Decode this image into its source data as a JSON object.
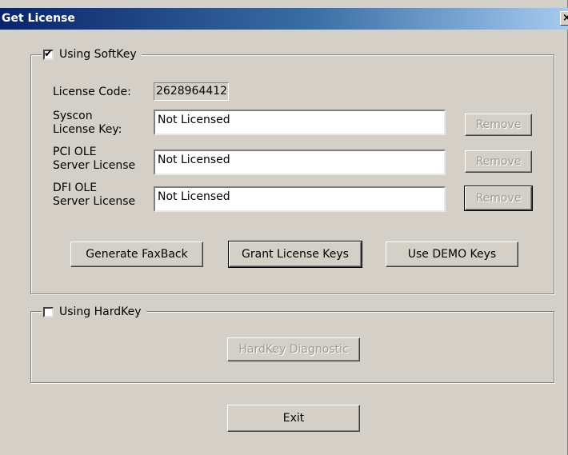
{
  "window": {
    "title": "Get License",
    "close_glyph": "×"
  },
  "softkey_group": {
    "checkbox_label": "Using SoftKey",
    "checked": true,
    "license_code_label": "License Code:",
    "license_code_value": "2628964412",
    "rows": [
      {
        "label_line1": "Syscon",
        "label_line2": "License Key:",
        "value": "Not Licensed",
        "remove_label": "Remove"
      },
      {
        "label_line1": "PCI OLE",
        "label_line2": "Server License",
        "value": "Not Licensed",
        "remove_label": "Remove"
      },
      {
        "label_line1": "DFI OLE",
        "label_line2": "Server License",
        "value": "Not Licensed",
        "remove_label": "Remove"
      }
    ],
    "buttons": {
      "generate_faxback": "Generate FaxBack",
      "grant_license_keys": "Grant License Keys",
      "use_demo_keys": "Use DEMO Keys"
    }
  },
  "hardkey_group": {
    "checkbox_label": "Using HardKey",
    "checked": false,
    "diagnostic_button": "HardKey Diagnostic"
  },
  "footer": {
    "exit_button": "Exit"
  }
}
